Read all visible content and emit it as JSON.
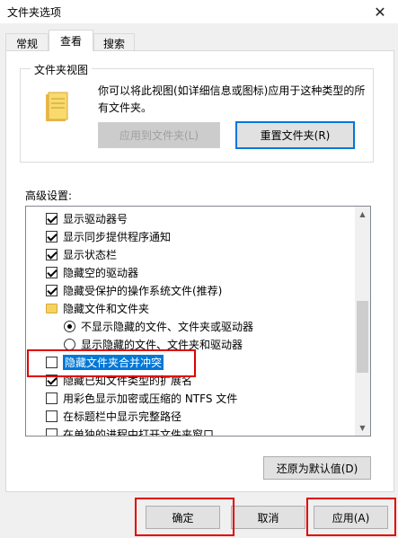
{
  "window": {
    "title": "文件夹选项",
    "close_glyph": "✕"
  },
  "tabs": [
    {
      "label": "常规",
      "active": false
    },
    {
      "label": "查看",
      "active": true
    },
    {
      "label": "搜索",
      "active": false
    }
  ],
  "folder_views": {
    "legend": "文件夹视图",
    "description": "你可以将此视图(如详细信息或图标)应用于这种类型的所有文件夹。",
    "apply_button": "应用到文件夹(L)",
    "reset_button": "重置文件夹(R)"
  },
  "advanced": {
    "label": "高级设置:",
    "items": [
      {
        "type": "checkbox",
        "checked": true,
        "label": "显示驱动器号"
      },
      {
        "type": "checkbox",
        "checked": true,
        "label": "显示同步提供程序通知"
      },
      {
        "type": "checkbox",
        "checked": true,
        "label": "显示状态栏"
      },
      {
        "type": "checkbox",
        "checked": true,
        "label": "隐藏空的驱动器"
      },
      {
        "type": "checkbox",
        "checked": true,
        "label": "隐藏受保护的操作系统文件(推荐)"
      },
      {
        "type": "folder",
        "label": "隐藏文件和文件夹"
      },
      {
        "type": "radio",
        "checked": true,
        "label": "不显示隐藏的文件、文件夹或驱动器"
      },
      {
        "type": "radio",
        "checked": false,
        "label": "显示隐藏的文件、文件夹和驱动器"
      },
      {
        "type": "checkbox",
        "checked": false,
        "label": "隐藏文件夹合并冲突",
        "selected": true
      },
      {
        "type": "checkbox",
        "checked": true,
        "label": "隐藏已知文件类型的扩展名"
      },
      {
        "type": "checkbox",
        "checked": false,
        "label": "用彩色显示加密或压缩的 NTFS 文件"
      },
      {
        "type": "checkbox",
        "checked": false,
        "label": "在标题栏中显示完整路径"
      },
      {
        "type": "checkbox",
        "checked": false,
        "label": "在单独的进程中打开文件夹窗口"
      }
    ],
    "restore_button": "还原为默认值(D)"
  },
  "footer": {
    "ok_button": "确定",
    "cancel_button": "取消",
    "apply_button": "应用(A)"
  },
  "colors": {
    "selection": "#0078d7",
    "highlight_box": "#e00000",
    "folder": "#f6d35f"
  }
}
